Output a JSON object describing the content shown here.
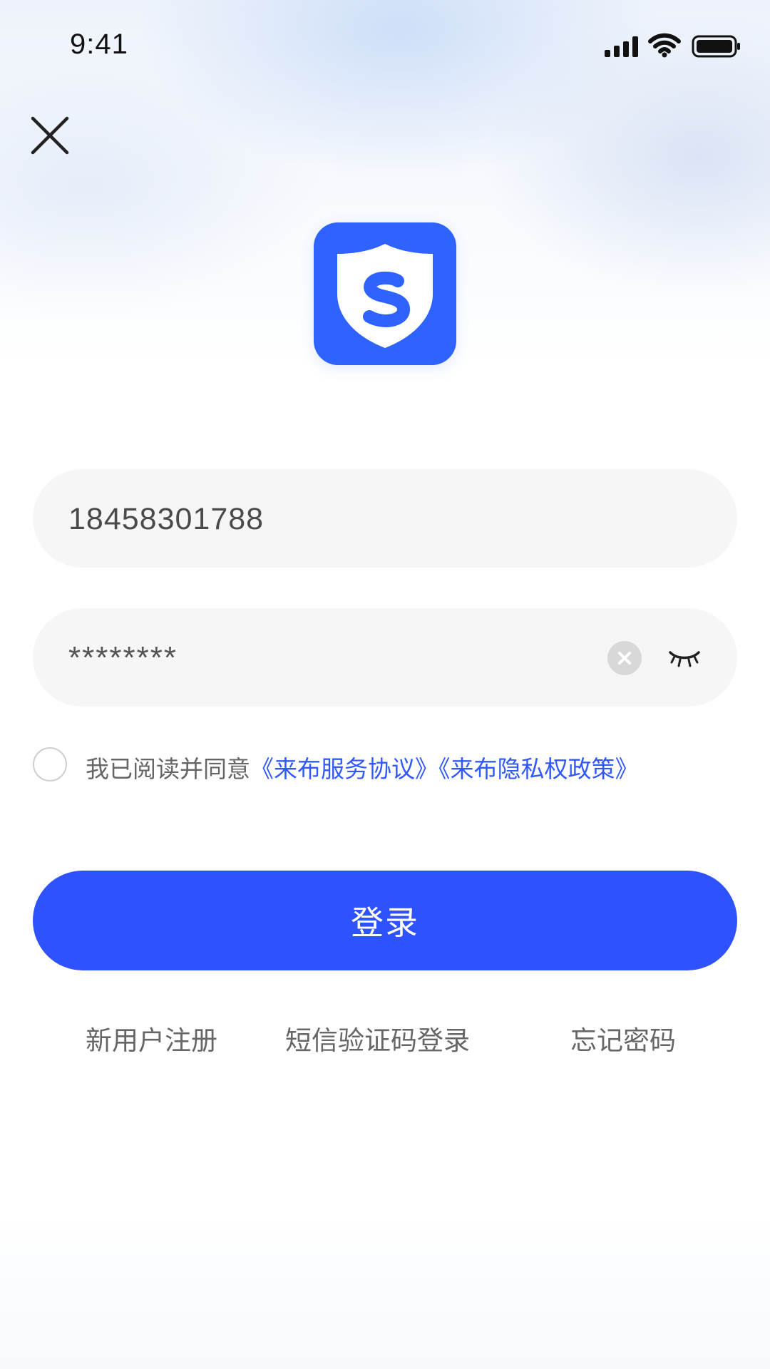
{
  "status_bar": {
    "time": "9:41"
  },
  "icons": {
    "close": "close-icon",
    "signal": "signal-icon",
    "wifi": "wifi-icon",
    "battery": "battery-icon",
    "clear": "clear-icon",
    "eye": "eye-closed-icon",
    "logo": "shield-s-icon"
  },
  "colors": {
    "primary": "#2f52ff",
    "link": "#3159ff",
    "field_bg": "#f6f6f6",
    "logo_bg": "#2f63ff"
  },
  "form": {
    "phone_value": "18458301788",
    "password_value": "********"
  },
  "agreement": {
    "prefix": "我已阅读并同意",
    "service_link": "《来布服务协议》",
    "privacy_link": "《来布隐私权政策》"
  },
  "actions": {
    "login_label": "登录"
  },
  "links": {
    "register": "新用户注册",
    "sms_login": "短信验证码登录",
    "forgot_password": "忘记密码"
  }
}
